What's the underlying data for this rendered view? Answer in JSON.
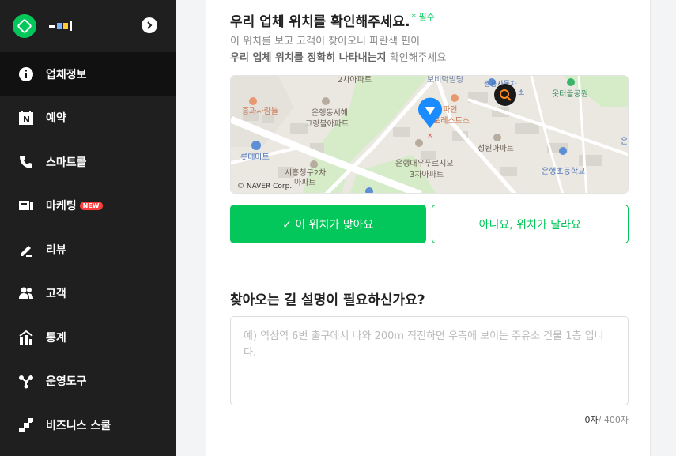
{
  "sidebar": {
    "store_name_colors": [
      "#ffffff",
      "#7fb0ff",
      "#ffcc33",
      "#ffffff"
    ],
    "items": [
      {
        "label": "업체정보",
        "icon": "info-icon"
      },
      {
        "label": "예약",
        "icon": "calendar-n-icon"
      },
      {
        "label": "스마트콜",
        "icon": "phone-icon"
      },
      {
        "label": "마케팅",
        "icon": "megaphone-icon",
        "badge": "NEW"
      },
      {
        "label": "리뷰",
        "icon": "pencil-icon"
      },
      {
        "label": "고객",
        "icon": "people-icon"
      },
      {
        "label": "통계",
        "icon": "chart-icon"
      },
      {
        "label": "운영도구",
        "icon": "share-icon"
      },
      {
        "label": "비즈니스 스쿨",
        "icon": "stairs-icon"
      }
    ]
  },
  "location": {
    "title": "우리 업체 위치를 확인해주세요.",
    "required": "* 필수",
    "desc_line1": "이 위치를 보고 고객이 찾아오니 파란색 핀이",
    "desc_line2_bold": "우리 업체 위치를 정확히 나타내는지",
    "desc_line2_rest": " 확인해주세요",
    "map_labels": {
      "apt2": "2차아파트",
      "bridge": "보비덕빌딩",
      "bank": "쌍용자동차",
      "bank2": "소",
      "park": "옷터골공원",
      "bakery": "홍과사람들",
      "eunhaeng": "은행동서해",
      "grand": "그랑블아파트",
      "pine": "파인",
      "forest": "포레스트스",
      "seongwon": "성원아파트",
      "lotte": "롯데마트",
      "daewoo": "은행대우푸르지오",
      "apt3": "3차아파트",
      "siheung": "시흥청구2차",
      "apt": "아파트",
      "school": "은행초등학교",
      "edge": "은",
      "copyright": "© NAVER Corp."
    },
    "confirm_button": "✓ 이 위치가 맞아요",
    "deny_button": "아니요, 위치가 달라요"
  },
  "directions": {
    "title": "찾아오는 길 설명이 필요하신가요?",
    "placeholder": "예) 역삼역 6번 출구에서 나와 200m 직진하면 우측에 보이는 주유소 건물 1층 입니다.",
    "count": "0자",
    "max": "/ 400자"
  },
  "colors": {
    "accent": "#03c75a",
    "pin": "#1a8cff",
    "badge": "#ff3c3c"
  }
}
